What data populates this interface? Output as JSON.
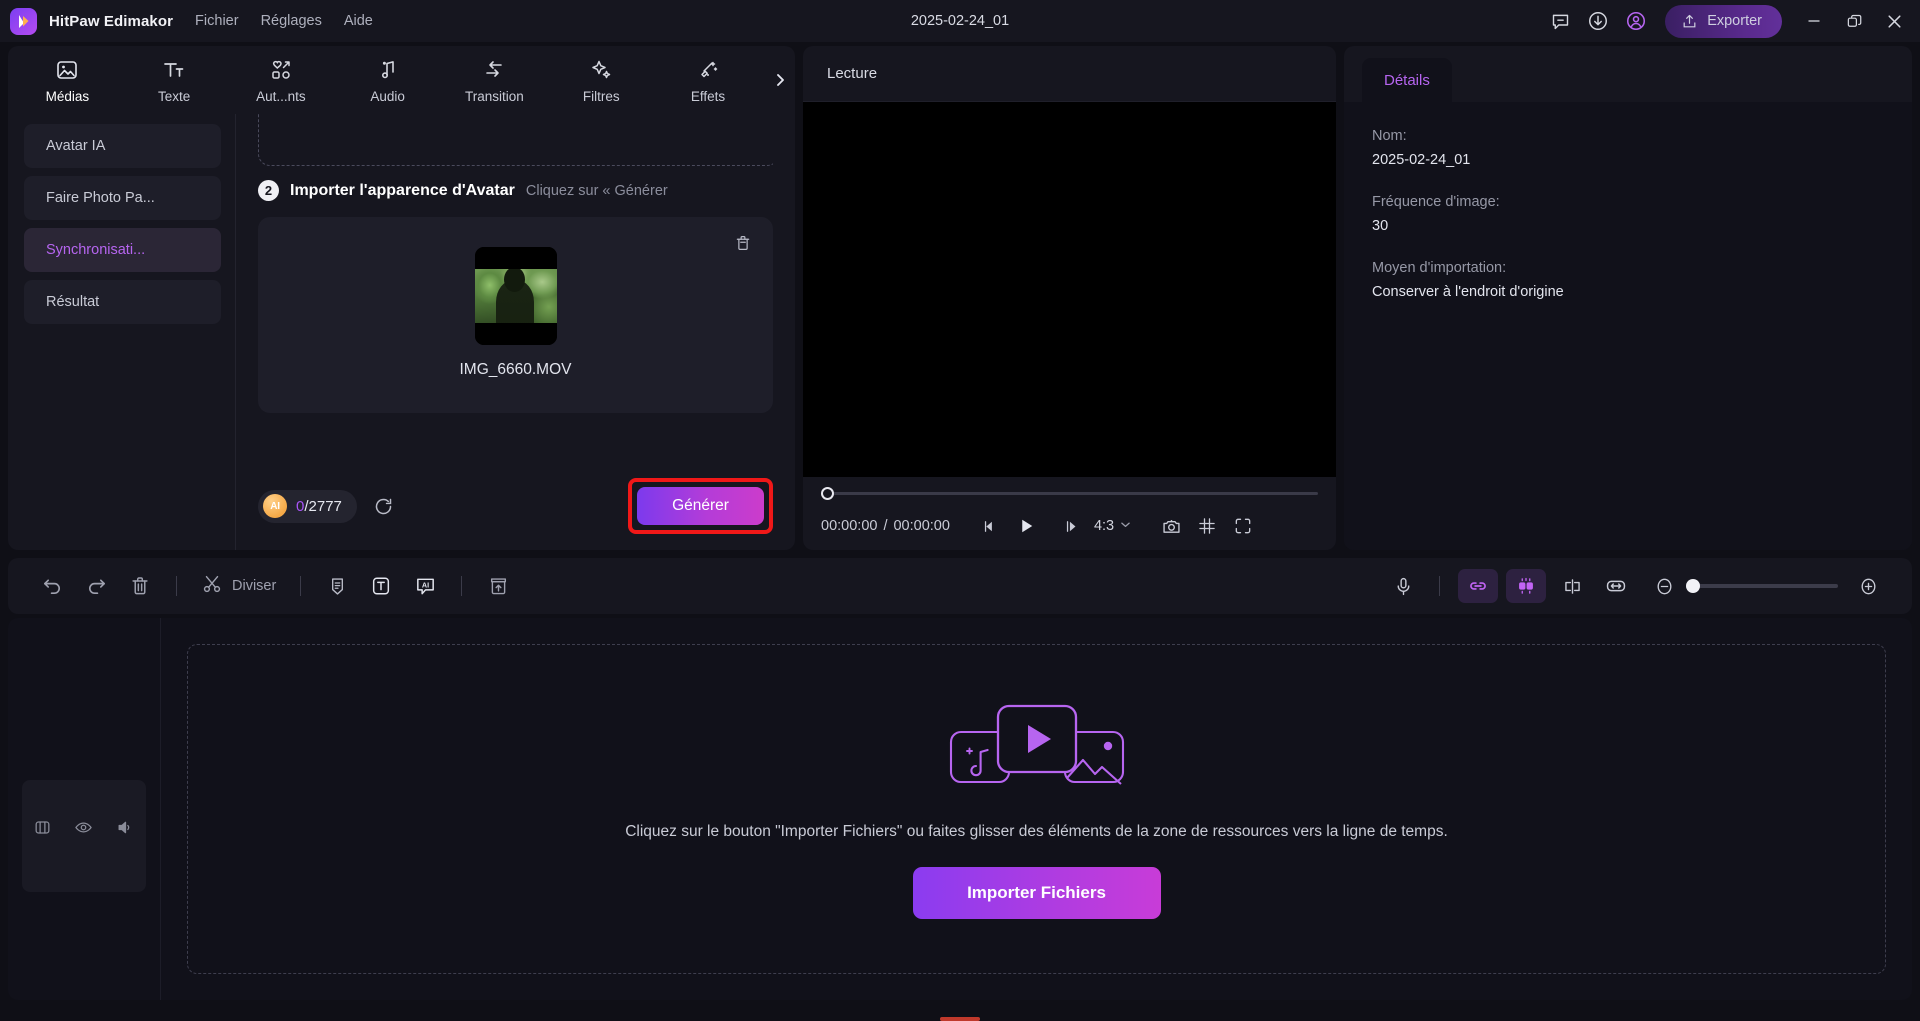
{
  "titlebar": {
    "app_name": "HitPaw Edimakor",
    "menus": [
      "Fichier",
      "Réglages",
      "Aide"
    ],
    "document_title": "2025-02-24_01",
    "icons": [
      "feedback-icon",
      "download-icon",
      "account-icon"
    ],
    "export_label": "Exporter",
    "window_controls": [
      "minimize",
      "restore",
      "close"
    ],
    "accent": "#b665f0"
  },
  "left_panel": {
    "tabs": [
      {
        "label": "Médias",
        "icon": "media-icon"
      },
      {
        "label": "Texte",
        "icon": "text-icon"
      },
      {
        "label": "Aut...nts",
        "icon": "elements-icon"
      },
      {
        "label": "Audio",
        "icon": "audio-icon"
      },
      {
        "label": "Transition",
        "icon": "transition-icon"
      },
      {
        "label": "Filtres",
        "icon": "filters-icon"
      },
      {
        "label": "Effets",
        "icon": "effects-icon"
      }
    ],
    "more_icon": "chevron-right-icon",
    "subnav": [
      {
        "label": "Avatar IA",
        "active": false
      },
      {
        "label": "Faire Photo Pa...",
        "active": false
      },
      {
        "label": "Synchronisati...",
        "active": true
      },
      {
        "label": "Résultat",
        "active": false
      }
    ],
    "step": {
      "number": "2",
      "title": "Importer l'apparence d'Avatar",
      "hint": "Cliquez sur « Générer"
    },
    "avatar_card": {
      "filename": "IMG_6660.MOV",
      "delete_icon": "trash-icon"
    },
    "footer": {
      "ai_badge": "AI",
      "credits_used": "0",
      "credits_total": "/2777",
      "refresh_icon": "refresh-icon",
      "generate_label": "Générer",
      "highlight_color": "#f01818"
    }
  },
  "preview": {
    "title": "Lecture",
    "current_time": "00:00:00",
    "separator": "/",
    "total_time": "00:00:00",
    "controls": [
      {
        "icon": "prev-frame-icon"
      },
      {
        "icon": "play-icon"
      },
      {
        "icon": "next-frame-icon"
      }
    ],
    "aspect_ratio": "4:3",
    "aspect_caret": "chevron-down-icon",
    "right_controls": [
      {
        "icon": "snapshot-icon"
      },
      {
        "icon": "grid-icon"
      },
      {
        "icon": "fullscreen-icon"
      }
    ]
  },
  "details": {
    "tab_label": "Détails",
    "fields": [
      {
        "label": "Nom:",
        "value": "2025-02-24_01"
      },
      {
        "label": "Fréquence d'image:",
        "value": "30"
      },
      {
        "label": "Moyen d'importation:",
        "value": "Conserver à l'endroit d'origine"
      }
    ]
  },
  "edit_toolbar": {
    "left": [
      {
        "icon": "undo-icon"
      },
      {
        "icon": "redo-icon"
      },
      {
        "icon": "delete-icon"
      }
    ],
    "split_label": "Diviser",
    "split_icon": "scissors-icon",
    "mid": [
      {
        "icon": "marker-icon"
      },
      {
        "icon": "text-box-icon"
      },
      {
        "icon": "ai-caption-icon"
      }
    ],
    "export_clip_icon": "export-clip-icon",
    "right": [
      {
        "icon": "microphone-icon",
        "active": false
      },
      {
        "icon": "link-clips-icon",
        "active": true
      },
      {
        "icon": "magnet-snap-icon",
        "active": true
      },
      {
        "icon": "split-clip-icon",
        "active": false
      },
      {
        "icon": "fit-timeline-icon",
        "active": false
      }
    ],
    "zoom_out_icon": "zoom-out-icon",
    "zoom_in_icon": "zoom-in-icon"
  },
  "timeline": {
    "track_controls": [
      {
        "icon": "lock-icon"
      },
      {
        "icon": "eye-icon"
      },
      {
        "icon": "speaker-icon"
      }
    ],
    "empty_art_icon": "media-placeholder-icon",
    "empty_text": "Cliquez sur le bouton \"Importer Fichiers\" ou faites glisser des éléments de la zone de ressources vers la ligne de temps.",
    "import_label": "Importer Fichiers"
  }
}
